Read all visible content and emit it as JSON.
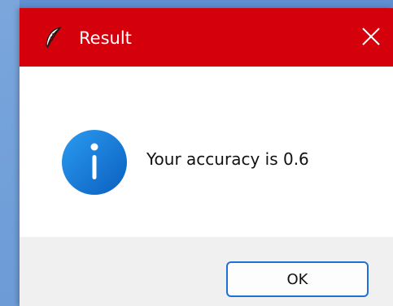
{
  "dialog": {
    "title": "Result",
    "app_icon": "feather-icon",
    "close_icon": "close-icon",
    "titlebar_color": "#d4000c",
    "message": "Your accuracy is 0.6",
    "message_icon": "info-icon",
    "info_icon_color": "#1478d6",
    "ok_label": "OK",
    "ok_border_color": "#1f6fd8"
  }
}
